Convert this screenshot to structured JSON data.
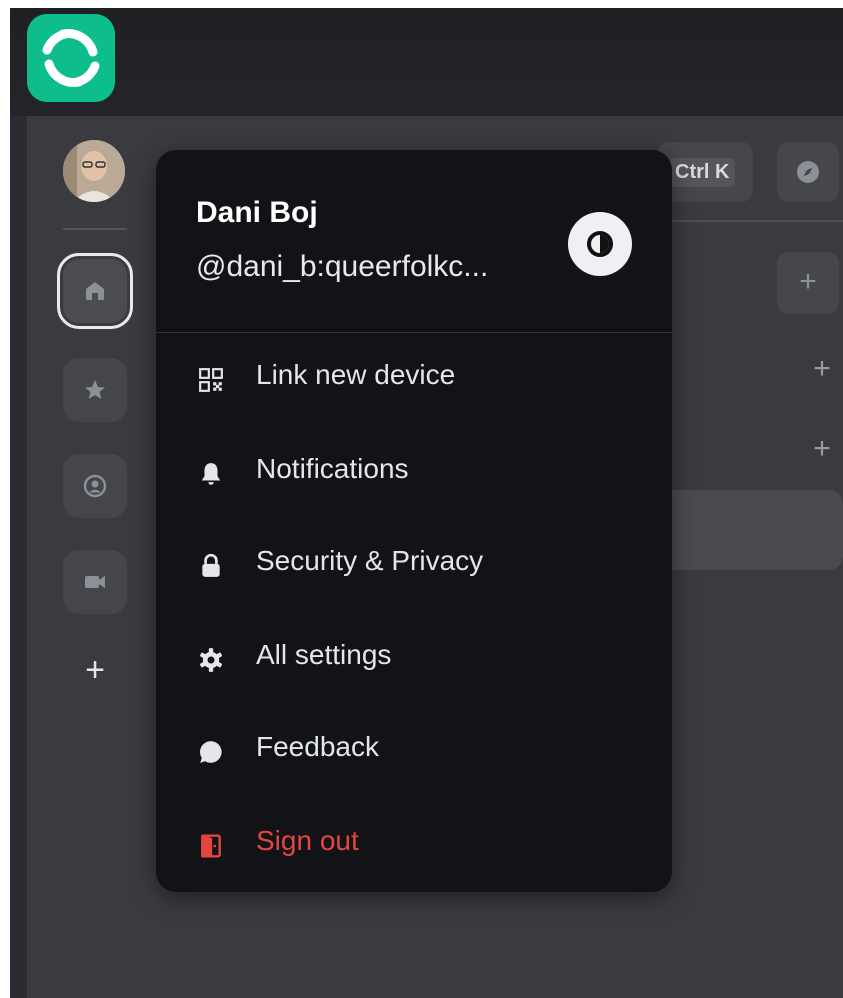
{
  "topbar": {
    "logo_icon": "element-logo-icon"
  },
  "spacebar": {
    "avatar_icon": "user-avatar",
    "spaces": [
      {
        "id": "home",
        "icon": "home-icon",
        "selected": true
      },
      {
        "id": "favourites",
        "icon": "star-icon"
      },
      {
        "id": "people",
        "icon": "person-circle-icon"
      },
      {
        "id": "video-rooms",
        "icon": "video-icon"
      }
    ],
    "add_label": "+"
  },
  "header": {
    "search_shortcut": "Ctrl K",
    "explore_icon": "compass-icon"
  },
  "room_list": {
    "add_labels": [
      "+",
      "+",
      "+"
    ]
  },
  "user_menu": {
    "name": "Dani Boj",
    "handle": "@dani_b:queerfolkc...",
    "theme_toggle_icon": "theme-contrast-icon",
    "items": [
      {
        "label": "Link new device",
        "icon": "qr-code-icon"
      },
      {
        "label": "Notifications",
        "icon": "bell-icon"
      },
      {
        "label": "Security & Privacy",
        "icon": "lock-icon"
      },
      {
        "label": "All settings",
        "icon": "gear-icon"
      },
      {
        "label": "Feedback",
        "icon": "chat-bubble-icon"
      },
      {
        "label": "Sign out",
        "icon": "sign-out-icon",
        "danger": true
      }
    ]
  },
  "colors": {
    "brand": "#0dbd8b",
    "menu_background": "#121317",
    "danger": "#e5453f"
  }
}
